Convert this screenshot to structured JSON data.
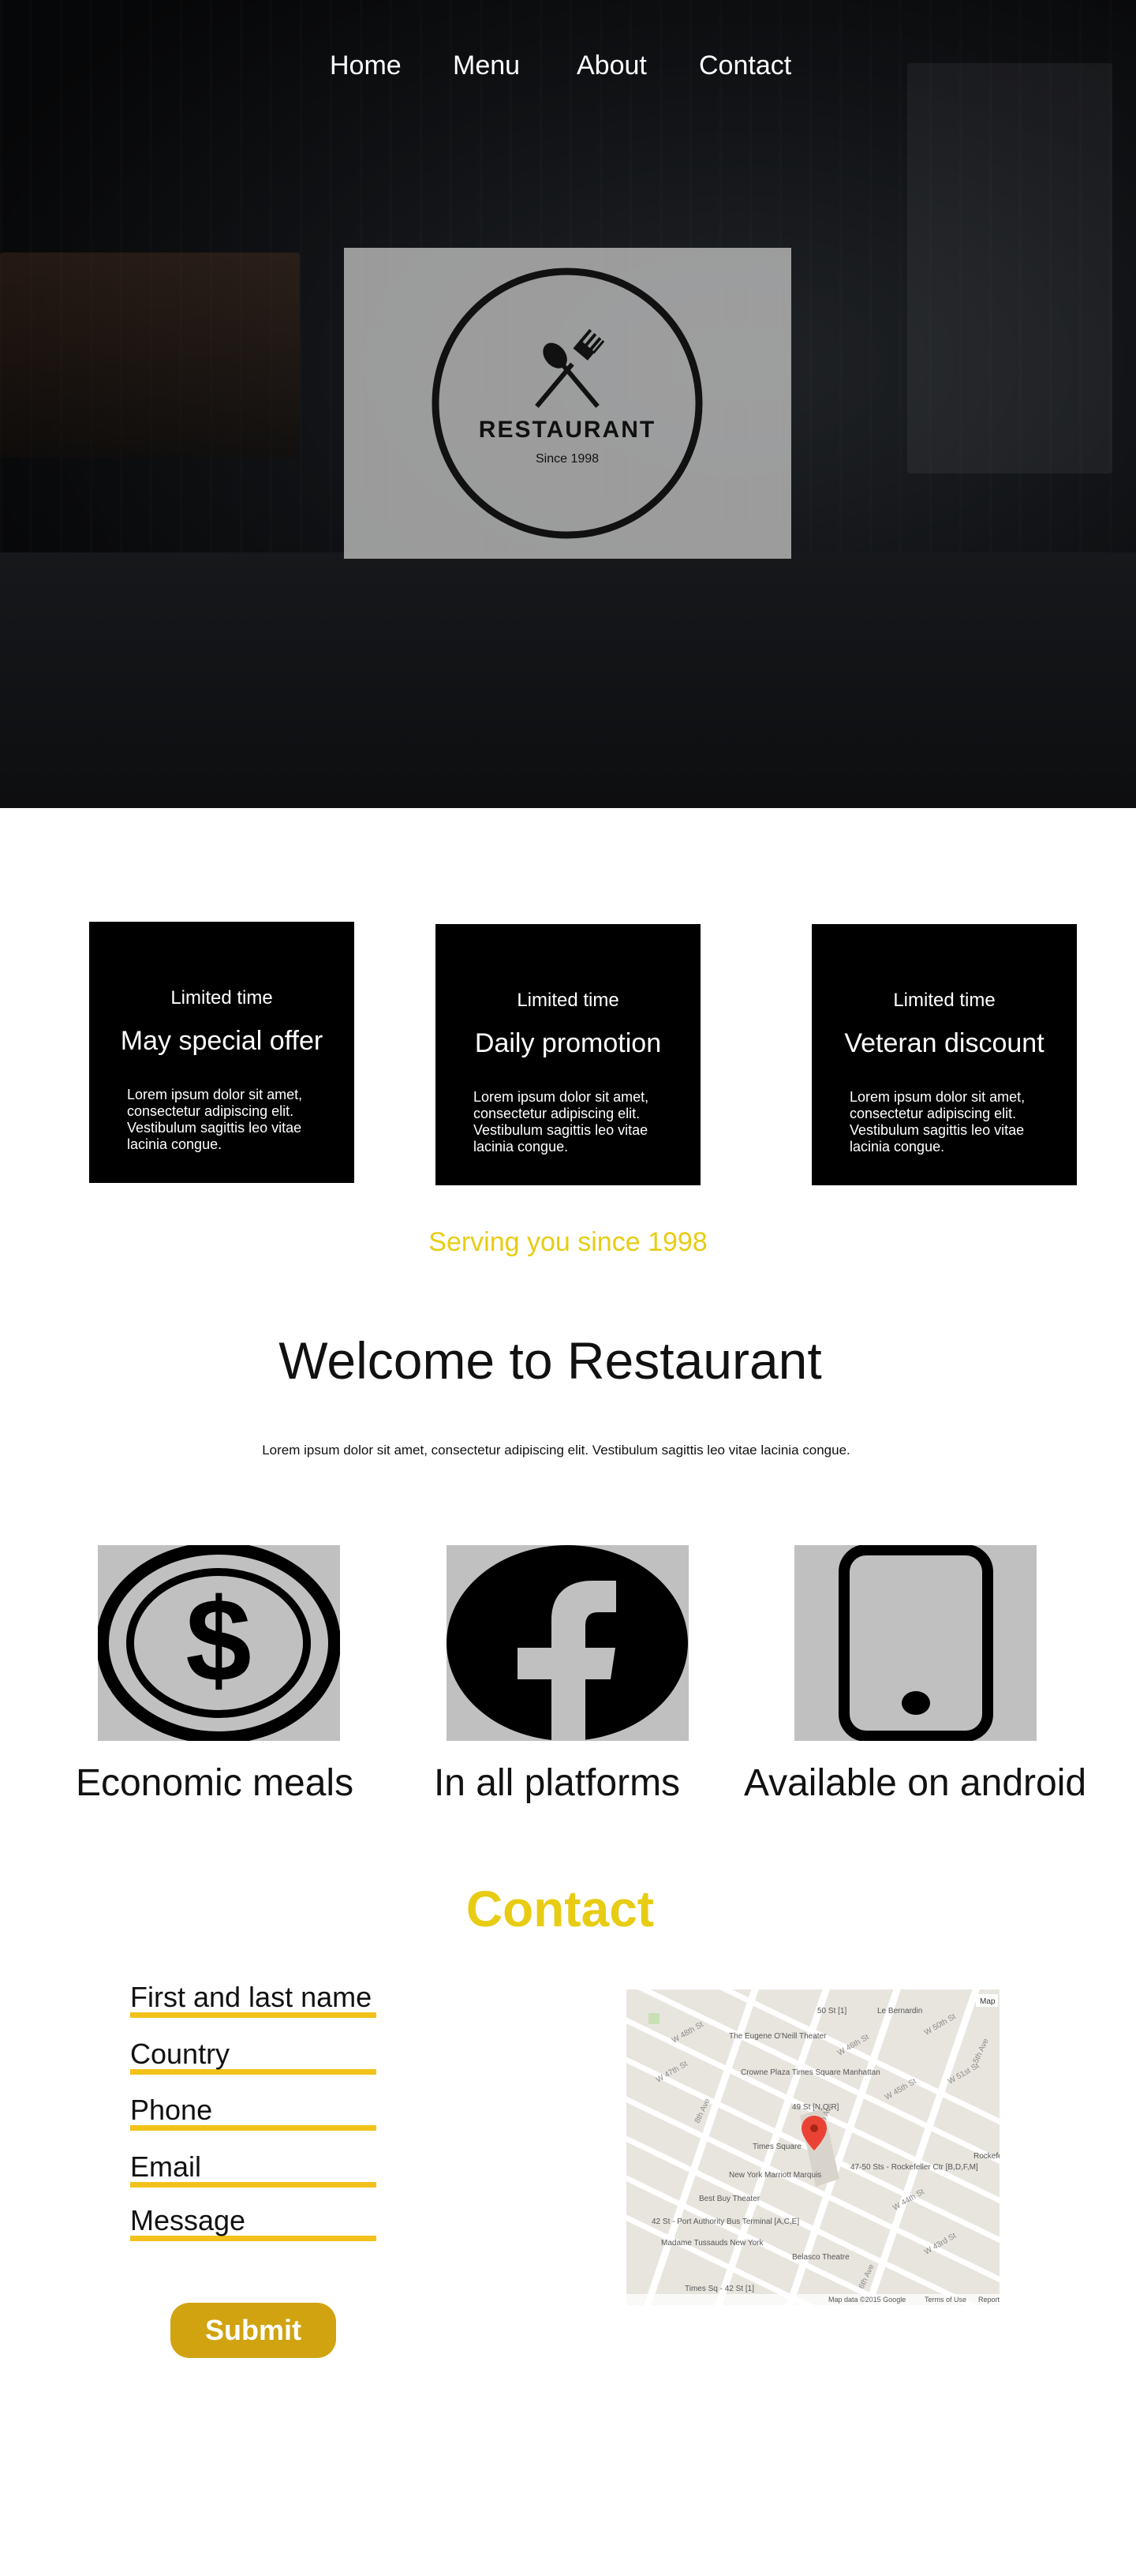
{
  "nav": {
    "items": [
      {
        "label": "Home"
      },
      {
        "label": "Menu"
      },
      {
        "label": "About"
      },
      {
        "label": "Contact"
      }
    ]
  },
  "logo": {
    "name": "RESTAURANT",
    "since": "Since 1998",
    "icon": "fork-and-spoon-icon"
  },
  "promos": [
    {
      "kicker": "Limited time",
      "title": "May special offer",
      "body": "Lorem ipsum dolor sit amet, consectetur adipiscing elit. Vestibulum sagittis leo vitae lacinia congue."
    },
    {
      "kicker": "Limited time",
      "title": "Daily promotion",
      "body": "Lorem ipsum dolor sit amet, consectetur adipiscing elit. Vestibulum sagittis leo vitae lacinia congue."
    },
    {
      "kicker": "Limited time",
      "title": "Veteran discount",
      "body": "Lorem ipsum dolor sit amet, consectetur adipiscing elit. Vestibulum sagittis leo vitae lacinia congue."
    }
  ],
  "tagline": "Serving you since 1998",
  "welcome": {
    "title": "Welcome to Restaurant",
    "lead": "Lorem ipsum dolor sit amet, consectetur adipiscing elit. Vestibulum sagittis leo vitae lacinia congue."
  },
  "features": [
    {
      "icon": "dollar-coin-icon",
      "label": "Economic meals"
    },
    {
      "icon": "facebook-icon",
      "label": "In all platforms"
    },
    {
      "icon": "smartphone-icon",
      "label": "Available on android"
    }
  ],
  "contact": {
    "title": "Contact",
    "fields": [
      {
        "label": "First and last name"
      },
      {
        "label": "Country"
      },
      {
        "label": "Phone"
      },
      {
        "label": "Email"
      },
      {
        "label": "Message"
      }
    ],
    "submit_label": "Submit"
  },
  "map": {
    "map_button": "Map",
    "attribution": "Map data ©2015 Google",
    "terms": "Terms of Use",
    "report": "Report",
    "labels": [
      "50 St [1]",
      "Le Bernardin",
      "The Eugene O'Neill Theater",
      "Crowne Plaza Times Square Manhattan",
      "49 St [N,Q,R]",
      "Times Square",
      "47-50 Sts - Rockefeller Ctr [B,D,F,M]",
      "New York Marriott Marquis",
      "Best Buy Theater",
      "42 St - Port Authority Bus Terminal [A,C,E]",
      "Madame Tussauds New York",
      "Belasco Theatre",
      "Times Sq - 42 St [1]",
      "Rockefeller",
      "W 48th St",
      "W 47th St",
      "W 46th St",
      "W 45th St",
      "W 44th St",
      "W 43rd St",
      "W 50th St",
      "W 51st St",
      "8th Ave",
      "7th Ave",
      "6th Ave",
      "5th Ave"
    ]
  },
  "colors": {
    "accent_yellow": "#e8cc13",
    "field_underline": "#f2c21a",
    "submit_bg": "#d1a310",
    "promo_bg": "#000000",
    "feature_bg": "#c0c0c0"
  }
}
